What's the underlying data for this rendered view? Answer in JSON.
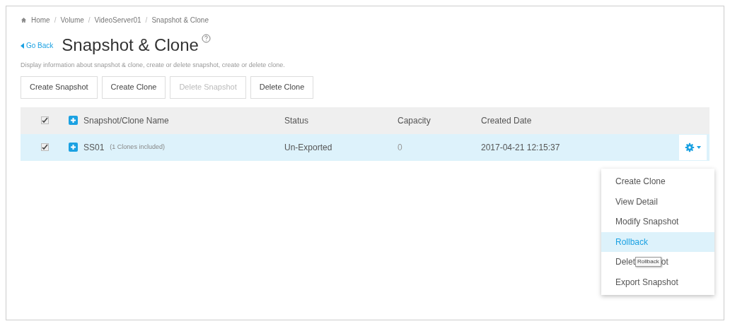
{
  "breadcrumb": [
    {
      "label": "Home",
      "kind": "home"
    },
    {
      "label": "Volume",
      "kind": "link"
    },
    {
      "label": "VideoServer01",
      "kind": "link"
    },
    {
      "label": "Snapshot & Clone",
      "kind": "current"
    }
  ],
  "breadcrumb_separator": "/",
  "back_link": "Go Back",
  "title": "Snapshot & Clone",
  "description": "Display information about snapshot & clone, create or delete snapshot, create or delete clone.",
  "toolbar": [
    {
      "label": "Create Snapshot",
      "disabled": false
    },
    {
      "label": "Create Clone",
      "disabled": false
    },
    {
      "label": "Delete Snapshot",
      "disabled": true
    },
    {
      "label": "Delete Clone",
      "disabled": false
    }
  ],
  "table": {
    "header_checked": true,
    "columns": [
      "Snapshot/Clone Name",
      "Status",
      "Capacity",
      "Created Date"
    ],
    "rows": [
      {
        "checked": true,
        "selected": true,
        "name": "SS01",
        "note": "(1 Clones included)",
        "status": "Un-Exported",
        "capacity": "0",
        "created": "2017-04-21 12:15:37"
      }
    ]
  },
  "menu": [
    {
      "label": "Create Clone",
      "selected": false
    },
    {
      "label": "View Detail",
      "selected": false
    },
    {
      "label": "Modify Snapshot",
      "selected": false
    },
    {
      "label": "Rollback",
      "selected": true
    },
    {
      "label": "Delet",
      "label_end": "ot",
      "tooltip": "Rollback",
      "selected": false
    },
    {
      "label": "Export Snapshot",
      "selected": false
    }
  ]
}
